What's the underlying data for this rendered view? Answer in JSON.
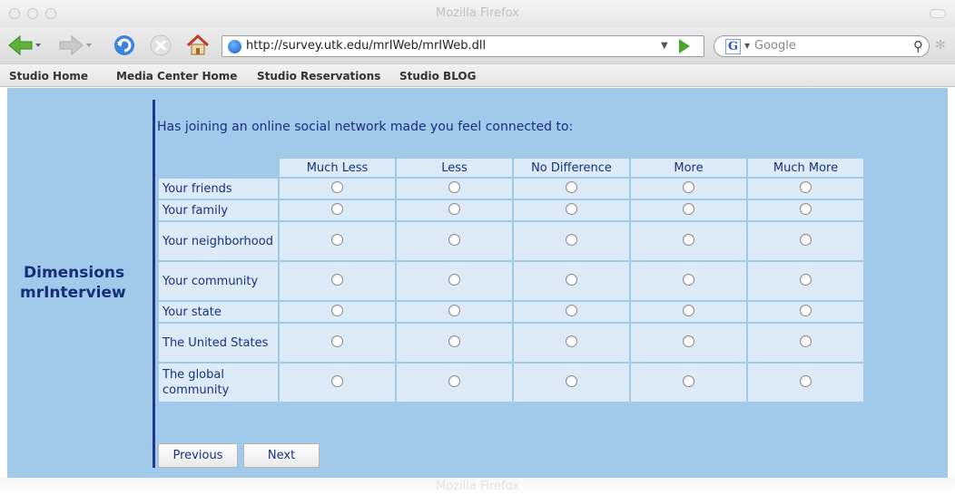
{
  "window": {
    "title": "Mozilla Firefox",
    "ghost_title": "Mozilla Firefox"
  },
  "toolbar": {
    "url": "http://survey.utk.edu/mrIWeb/mrIWeb.dll",
    "search_placeholder": "Google",
    "search_engine_letter": "G"
  },
  "bookmarks": [
    {
      "label": "Studio Home"
    },
    {
      "label": "Media Center Home"
    },
    {
      "label": "Studio Reservations"
    },
    {
      "label": "Studio BLOG"
    }
  ],
  "brand": {
    "line1": "Dimensions",
    "line2": "mrInterview"
  },
  "survey": {
    "question": "Has joining an online social network made you feel connected to:",
    "columns": [
      "Much Less",
      "Less",
      "No Difference",
      "More",
      "Much More"
    ],
    "rows": [
      {
        "label": "Your friends",
        "selected": null
      },
      {
        "label": "Your family",
        "selected": null
      },
      {
        "label": "Your neighborhood",
        "selected": null
      },
      {
        "label": "Your community",
        "selected": null
      },
      {
        "label": "Your state",
        "selected": null
      },
      {
        "label": "The United States",
        "selected": null
      },
      {
        "label": "The global community",
        "selected": null
      }
    ],
    "previous_label": "Previous",
    "next_label": "Next"
  },
  "colors": {
    "page_background": "#a1c9e9",
    "cell_background": "#dcebf7",
    "text": "#1a2f7f",
    "brand_text": "#152e7a"
  },
  "icons": {
    "back": "back-arrow-icon",
    "forward": "forward-arrow-icon",
    "reload": "reload-icon",
    "stop": "stop-icon",
    "home": "home-icon",
    "site": "globe-icon",
    "go": "go-arrow-icon",
    "search": "magnifier-icon"
  }
}
